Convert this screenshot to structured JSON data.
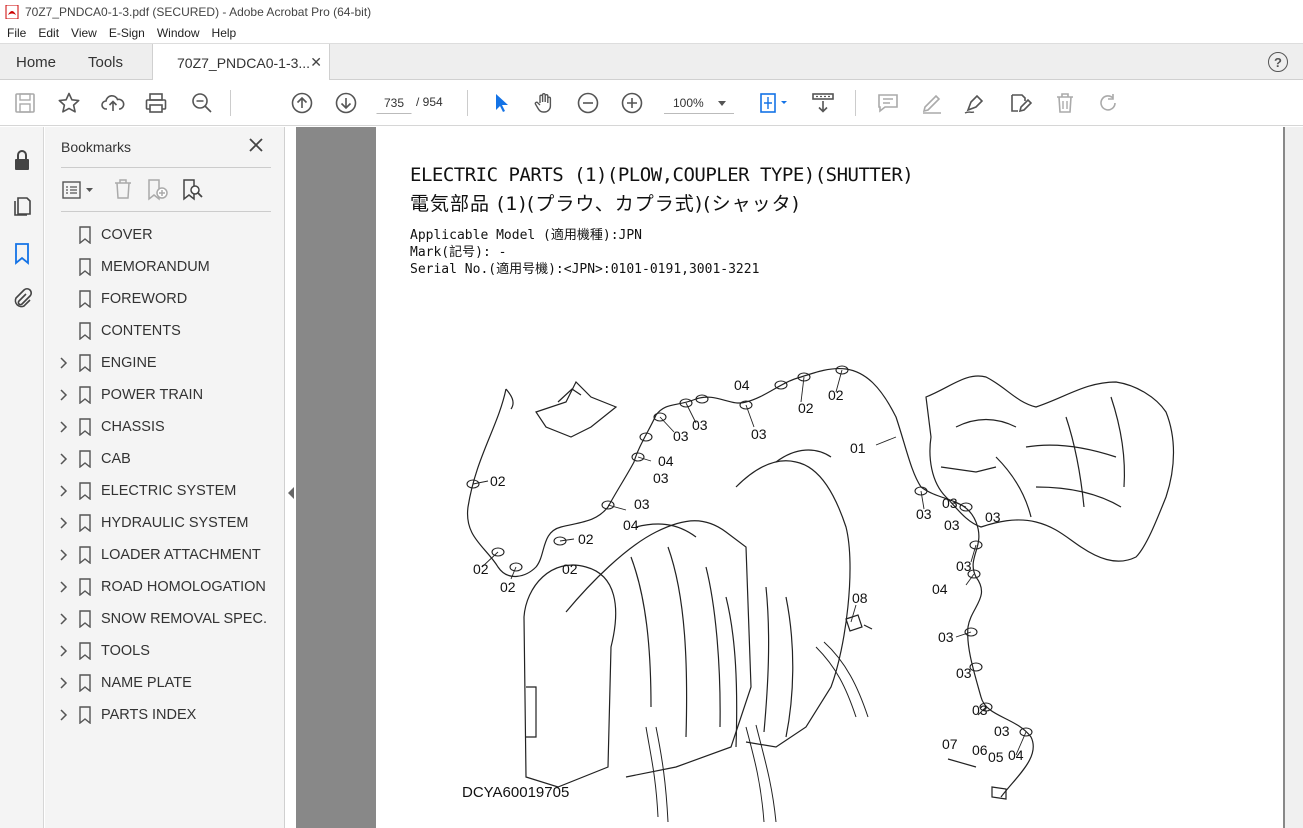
{
  "window": {
    "title": "70Z7_PNDCA0-1-3.pdf (SECURED) - Adobe Acrobat Pro (64-bit)"
  },
  "menu": [
    "File",
    "Edit",
    "View",
    "E-Sign",
    "Window",
    "Help"
  ],
  "tabs": {
    "home": "Home",
    "tools": "Tools",
    "document": "70Z7_PNDCA0-1-3..."
  },
  "toolbar": {
    "current_page": "735",
    "page_total": "/ 954",
    "zoom": "100%"
  },
  "bookmarks": {
    "title": "Bookmarks",
    "items": [
      {
        "label": "COVER",
        "expandable": false
      },
      {
        "label": "MEMORANDUM",
        "expandable": false
      },
      {
        "label": "FOREWORD",
        "expandable": false
      },
      {
        "label": "CONTENTS",
        "expandable": false
      },
      {
        "label": "ENGINE",
        "expandable": true
      },
      {
        "label": "POWER TRAIN",
        "expandable": true
      },
      {
        "label": "CHASSIS",
        "expandable": true
      },
      {
        "label": "CAB",
        "expandable": true
      },
      {
        "label": "ELECTRIC SYSTEM",
        "expandable": true
      },
      {
        "label": "HYDRAULIC SYSTEM",
        "expandable": true
      },
      {
        "label": "LOADER ATTACHMENT",
        "expandable": true
      },
      {
        "label": "ROAD HOMOLOGATION",
        "expandable": true
      },
      {
        "label": "SNOW REMOVAL SPEC.",
        "expandable": true
      },
      {
        "label": "TOOLS",
        "expandable": true
      },
      {
        "label": "NAME PLATE",
        "expandable": true
      },
      {
        "label": "PARTS INDEX",
        "expandable": true
      }
    ]
  },
  "document": {
    "title_en": "ELECTRIC PARTS (1)(PLOW,COUPLER TYPE)(SHUTTER)",
    "title_ja": "電気部品 (1)(プラウ、カプラ式)(シャッタ)",
    "model_line": "Applicable Model (適用機種):JPN",
    "mark_line": "Mark(記号): -",
    "serial_line": "Serial No.(適用号機):<JPN>:0101-0191,3001-3221",
    "drawing_code": "DCYA60019705",
    "ref_labels": [
      "01",
      "02",
      "02",
      "02",
      "02",
      "02",
      "02",
      "02",
      "03",
      "03",
      "03",
      "03",
      "03",
      "03",
      "03",
      "03",
      "03",
      "03",
      "03",
      "03",
      "03",
      "03",
      "04",
      "04",
      "04",
      "04",
      "04",
      "05",
      "06",
      "07",
      "08"
    ]
  },
  "colors": {
    "accent_blue": "#1473e6",
    "doc_background": "#888888",
    "panel_background": "#f4f4f4"
  }
}
